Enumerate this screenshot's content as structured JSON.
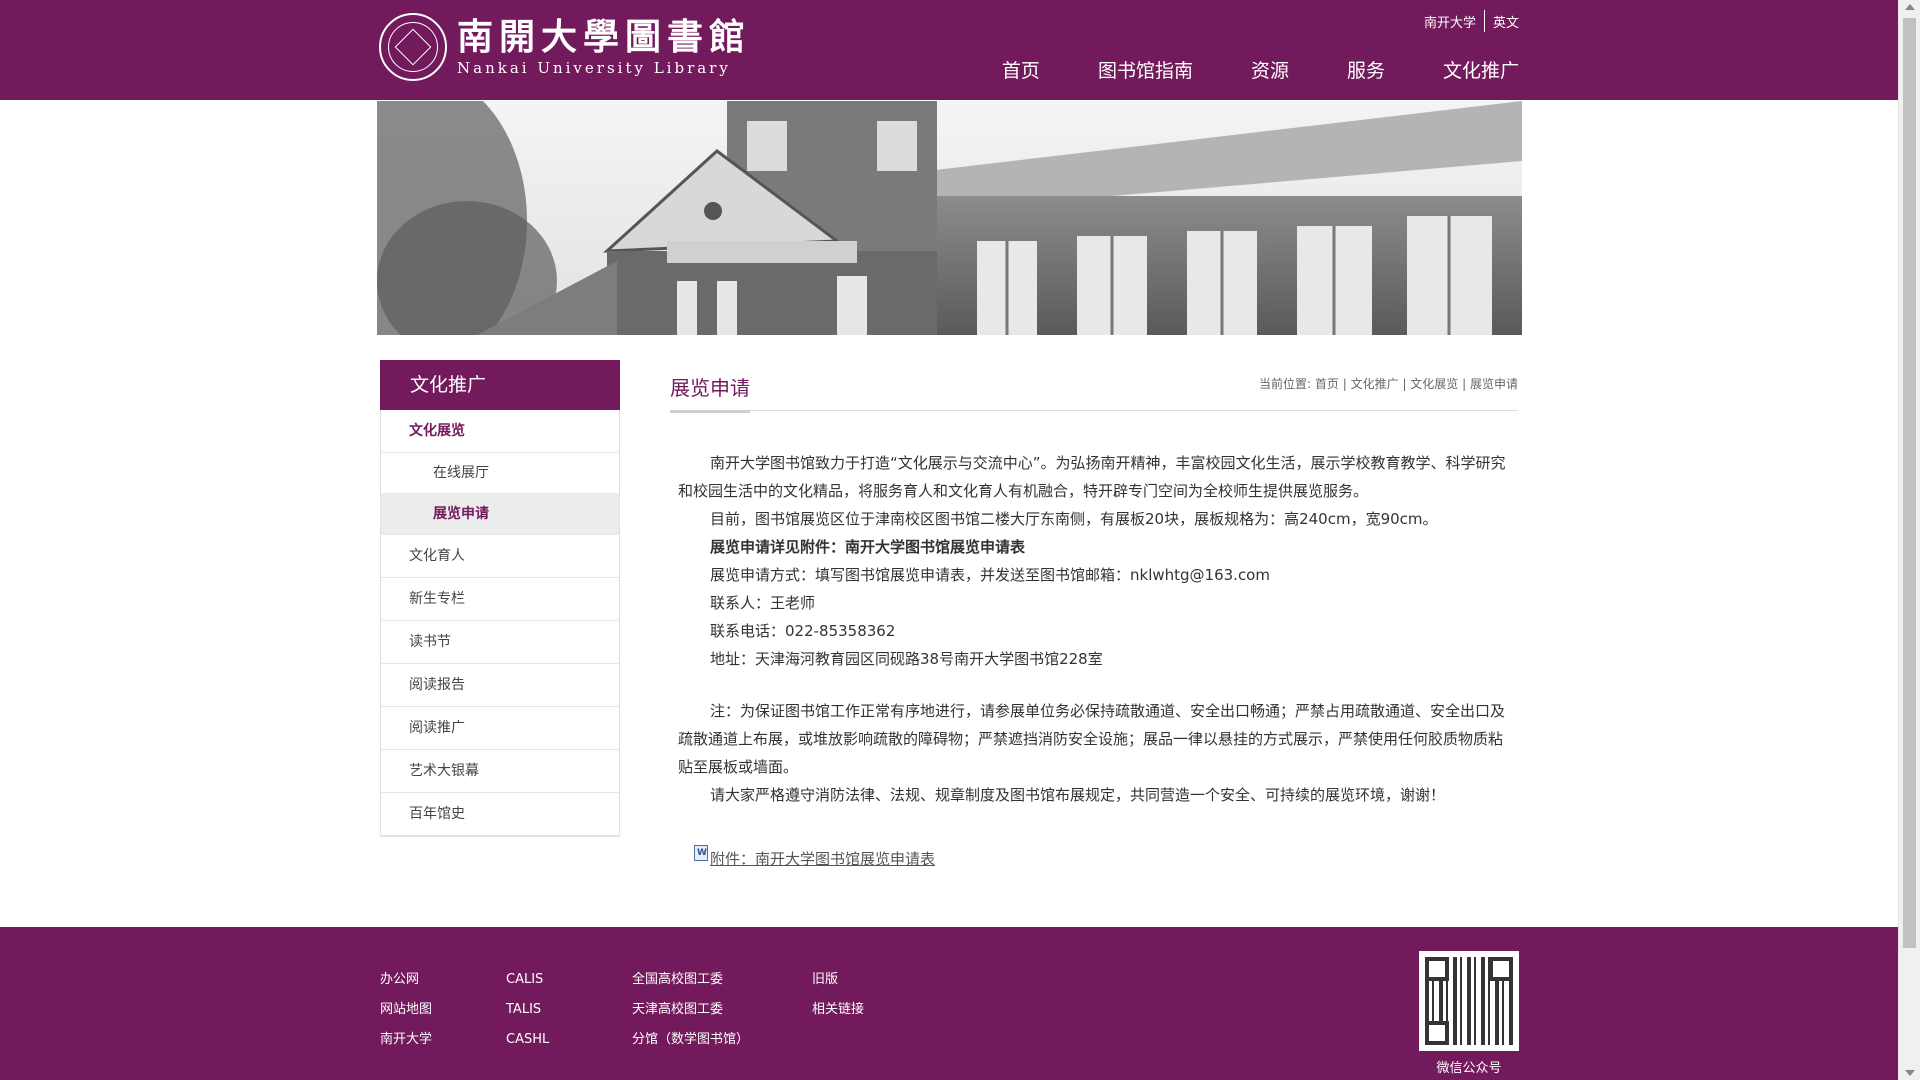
{
  "header": {
    "logo_cn": "南開大學圖書館",
    "logo_en": "Nankai University Library",
    "top_links": [
      "南开大学",
      "英文"
    ],
    "nav": [
      "首页",
      "图书馆指南",
      "资源",
      "服务",
      "文化推广"
    ]
  },
  "sidebar": {
    "title": "文化推广",
    "items": [
      {
        "label": "文化展览",
        "sub": [
          "在线展厅",
          "展览申请"
        ]
      },
      {
        "label": "文化育人"
      },
      {
        "label": "新生专栏"
      },
      {
        "label": "读书节"
      },
      {
        "label": "阅读报告"
      },
      {
        "label": "阅读推广"
      },
      {
        "label": "艺术大银幕"
      },
      {
        "label": "百年馆史"
      }
    ]
  },
  "main": {
    "title": "展览申请",
    "breadcrumb_prefix": "当前位置:",
    "breadcrumb": [
      "首页",
      "文化推广",
      "文化展览",
      "展览申请"
    ],
    "paragraphs": [
      "南开大学图书馆致力于打造“文化展示与交流中心”。为弘扬南开精神，丰富校园文化生活，展示学校教育教学、科学研究和校园生活中的文化精品，将服务育人和文化育人有机融合，特开辟专门空间为全校师生提供展览服务。",
      "目前，图书馆展览区位于津南校区图书馆二楼大厅东南侧，有展板20块，展板规格为：高240cm，宽90cm。",
      "展览申请详见附件：南开大学图书馆展览申请表",
      "展览申请方式：填写图书馆展览申请表，并发送至图书馆邮箱：nklwhtg@163.com",
      "联系人：王老师",
      "联系电话：022-85358362",
      "地址：天津海河教育园区同砚路38号南开大学图书馆228室",
      "注：为保证图书馆工作正常有序地进行，请参展单位务必保持疏散通道、安全出口畅通；严禁占用疏散通道、安全出口及疏散通道上布展，或堆放影响疏散的障碍物；严禁遮挡消防安全设施；展品一律以悬挂的方式展示，严禁使用任何胶质物质粘贴至展板或墙面。",
      "请大家严格遵守消防法律、法规、规章制度及图书馆布展规定，共同营造一个安全、可持续的展览环境，谢谢！"
    ],
    "attachment": "附件：南开大学图书馆展览申请表"
  },
  "footer": {
    "col1": [
      "办公网",
      "网站地图",
      "南开大学"
    ],
    "col2": [
      "CALIS",
      "TALIS",
      "CASHL"
    ],
    "col3": [
      "全国高校图工委",
      "天津高校图工委",
      "分馆（数学图书馆）"
    ],
    "col4": [
      "旧版",
      "相关链接"
    ],
    "qr_caption": "微信公众号"
  },
  "colors": {
    "brand": "#731a5c"
  }
}
